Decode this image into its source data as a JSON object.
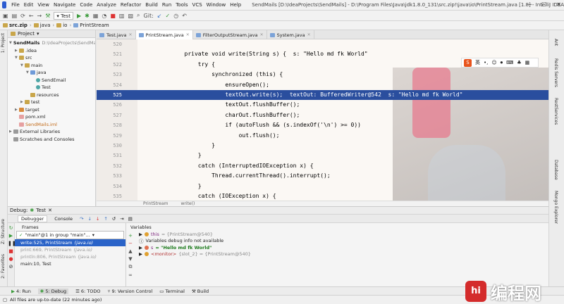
{
  "menubar": {
    "items": [
      "File",
      "Edit",
      "View",
      "Navigate",
      "Code",
      "Analyze",
      "Refactor",
      "Build",
      "Run",
      "Tools",
      "VCS",
      "Window",
      "Help"
    ],
    "title": "SendMails [D:\\IdeaProjects\\SendMails] - D:\\Program Files\\Java\\jdk1.8.0_131\\src.zip!\\java\\io\\PrintStream.java [1.8] - IntelliJ IDEA"
  },
  "toolbar": {
    "run_config": "Test",
    "git_label": "Git:"
  },
  "navbar": {
    "crumbs": [
      "src.zip",
      "java",
      "io",
      "PrintStream"
    ]
  },
  "project": {
    "header": "Project",
    "tree": [
      {
        "label": "SendMails",
        "path": "D:\\IdeaProjects\\SendMails",
        "depth": 0,
        "icon": "folder",
        "bold": true
      },
      {
        "label": ".idea",
        "depth": 1,
        "icon": "folder"
      },
      {
        "label": "src",
        "depth": 1,
        "icon": "folder"
      },
      {
        "label": "main",
        "depth": 2,
        "icon": "folder"
      },
      {
        "label": "java",
        "depth": 3,
        "icon": "folder-blue"
      },
      {
        "label": "SendEmail",
        "depth": 4,
        "icon": "class"
      },
      {
        "label": "Test",
        "depth": 4,
        "icon": "class"
      },
      {
        "label": "resources",
        "depth": 3,
        "icon": "folder"
      },
      {
        "label": "test",
        "depth": 2,
        "icon": "folder"
      },
      {
        "label": "target",
        "depth": 1,
        "icon": "folder-orange"
      },
      {
        "label": "pom.xml",
        "depth": 1,
        "icon": "doc"
      },
      {
        "label": "SendMails.iml",
        "depth": 1,
        "icon": "doc"
      },
      {
        "label": "External Libraries",
        "depth": 0,
        "icon": "lib"
      },
      {
        "label": "Scratches and Consoles",
        "depth": 0,
        "icon": "lib"
      }
    ]
  },
  "tabs": [
    {
      "label": "Test.java",
      "active": false
    },
    {
      "label": "PrintStream.java",
      "active": true
    },
    {
      "label": "FilterOutputStream.java",
      "active": false
    },
    {
      "label": "System.java",
      "active": false
    }
  ],
  "editor": {
    "lines": [
      {
        "num": "520",
        "code": ""
      },
      {
        "num": "521",
        "code": "        private void write(String s) {  s: \"Hello md fk World\""
      },
      {
        "num": "522",
        "code": "            try {"
      },
      {
        "num": "523",
        "code": "                synchronized (this) {"
      },
      {
        "num": "524",
        "code": "                    ensureOpen();"
      },
      {
        "num": "525",
        "code": "                    textOut.write(s);  textOut: BufferedWriter@542  s: \"Hello md fk World\"",
        "highlight": true
      },
      {
        "num": "526",
        "code": "                    textOut.flushBuffer();"
      },
      {
        "num": "527",
        "code": "                    charOut.flushBuffer();"
      },
      {
        "num": "528",
        "code": "                    if (autoFlush && (s.indexOf('\\n') >= 0))"
      },
      {
        "num": "529",
        "code": "                        out.flush();"
      },
      {
        "num": "530",
        "code": "                }"
      },
      {
        "num": "531",
        "code": "            }"
      },
      {
        "num": "532",
        "code": "            catch (InterruptedIOException x) {"
      },
      {
        "num": "533",
        "code": "                Thread.currentThread().interrupt();"
      },
      {
        "num": "534",
        "code": "            }"
      },
      {
        "num": "535",
        "code": "            catch (IOException x) {"
      }
    ],
    "breadcrumb": [
      "PrintStream",
      "write()"
    ]
  },
  "ime": {
    "label": "英"
  },
  "debug": {
    "title": "Debug:",
    "config": "Test",
    "tabs": [
      "Debugger",
      "Console"
    ],
    "frames_header": "Frames",
    "thread": "\"main\"@1 in group \"main\"...",
    "frames": [
      {
        "text": "write:525, PrintStream",
        "cls": "(java.io)",
        "selected": true
      },
      {
        "text": "print:669, PrintStream",
        "cls": "(java.io)",
        "dim": true
      },
      {
        "text": "println:806, PrintStream",
        "cls": "(java.io)",
        "dim": true
      },
      {
        "text": "main:10, Test",
        "cls": "",
        "dim": false
      }
    ],
    "variables_header": "Variables",
    "variables": [
      {
        "name": "this",
        "value": "= {PrintStream@540}",
        "color": "#e0a030"
      },
      {
        "name": "",
        "value": "Variables debug info not available",
        "color": "#e0a030"
      },
      {
        "name": "s",
        "value": "= \"Hello md fk World\"",
        "color": "#e07050",
        "string": true
      },
      {
        "name": "<monitor>",
        "value": "{slot_2} = {PrintStream@540}",
        "color": "#e0a030"
      }
    ]
  },
  "bottom_tabs": [
    "4: Run",
    "5: Debug",
    "6: TODO",
    "9: Version Control",
    "Terminal",
    "Build"
  ],
  "status": "All files are up-to-date (22 minutes ago)",
  "left_labels": [
    "1: Project",
    "Z: Structure",
    "2: Favorites"
  ],
  "right_labels": [
    "Ant",
    "Redis Servers",
    "RestServices",
    "Database",
    "Mongo Explorer"
  ],
  "watermark": {
    "logo": "hi",
    "text": "编程网"
  }
}
